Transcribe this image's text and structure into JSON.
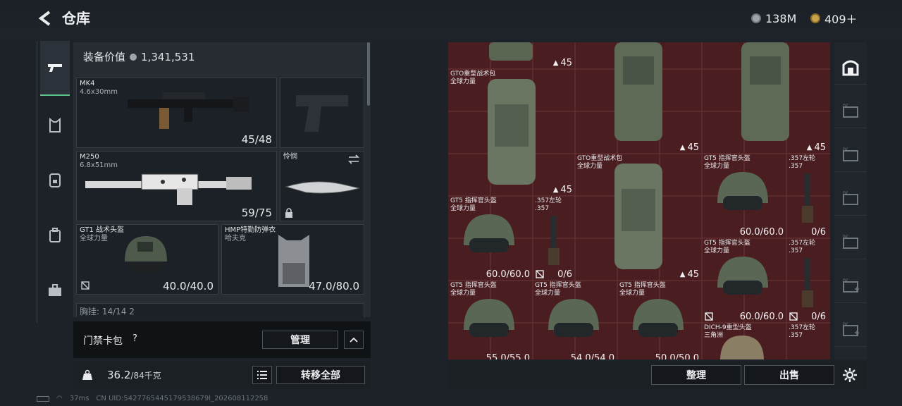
{
  "header": {
    "title": "仓库",
    "currency": [
      {
        "icon": "silver-coin-icon",
        "value": "138M"
      },
      {
        "icon": "gold-coin-icon",
        "value": "409＋"
      }
    ]
  },
  "equipment": {
    "value_label": "装备价值",
    "value": "1,341,531",
    "slots": {
      "primary1": {
        "name": "MK4",
        "caliber": "4.6x30mm",
        "durability": "45/48"
      },
      "primary2": {
        "name": "M250",
        "caliber": "6.8x51mm",
        "durability": "59/75"
      },
      "melee": {
        "name": "怜悯"
      },
      "helmet": {
        "name": "GT1 战术头盔",
        "sub": "全球力量",
        "durability": "40.0/40.0"
      },
      "armor": {
        "name": "HMP特勤防弹衣",
        "sub": "哈夫克",
        "durability": "47.0/80.0"
      }
    },
    "chest_rig_row": "胸挂: 14/14  2"
  },
  "access_card": {
    "label": "门禁卡包",
    "help": "?",
    "manage_label": "管理"
  },
  "weight": {
    "current": "36.2",
    "max": "/84千克"
  },
  "transfer_all_label": "转移全部",
  "inventory": {
    "items": [
      {
        "id": "bag-top",
        "qty": "45"
      },
      {
        "id": "gto-bag-1",
        "name": "GTO重型战术包",
        "sub": "全球力量",
        "qty": "45"
      },
      {
        "id": "bag-top-2",
        "qty": "45"
      },
      {
        "id": "bag-top-3",
        "qty": "45"
      },
      {
        "id": "gto-bag-2",
        "name": "GTO重型战术包",
        "sub": "全球力量",
        "qty": "45"
      },
      {
        "id": "gt5-a",
        "name": "GT5 指挥官头盔",
        "sub": "全球力量",
        "qty": "60.0/60.0"
      },
      {
        "id": "revolver-a",
        "name": ".357左轮",
        "sub": ".357",
        "qty": "0/6"
      },
      {
        "id": "gt5-b",
        "name": "GT5 指挥官头盔",
        "sub": "全球力量",
        "qty": "60.0/60.0"
      },
      {
        "id": "revolver-b",
        "name": ".357左轮",
        "sub": ".357",
        "qty": "0/6"
      },
      {
        "id": "gt5-c",
        "name": "GT5 指挥官头盔",
        "sub": "全球力量",
        "qty": "60.0/60.0"
      },
      {
        "id": "revolver-c",
        "name": ".357左轮",
        "sub": ".357",
        "qty": "0/6"
      },
      {
        "id": "gt5-d",
        "name": "GT5 指挥官头盔",
        "sub": "全球力量",
        "qty": "55.0/55.0"
      },
      {
        "id": "gt5-e",
        "name": "GT5 指挥官头盔",
        "sub": "全球力量",
        "qty": "54.0/54.0"
      },
      {
        "id": "gt5-f",
        "name": "GT5 指挥官头盔",
        "sub": "全球力量",
        "qty": "50.0/50.0"
      },
      {
        "id": "dich9",
        "name": "DICH-9重型头盔",
        "sub": "三角洲",
        "qty": ""
      },
      {
        "id": "revolver-d",
        "name": ".357左轮",
        "sub": ".357",
        "qty": ""
      }
    ]
  },
  "actions": {
    "sort_label": "整理",
    "sell_label": "出售"
  },
  "right_nav": [
    "vault-icon",
    "case-iv-icon",
    "case-iv-icon",
    "case-iv-icon",
    "case-iv-icon",
    "case-iv-add-icon",
    "case-iv-add-icon"
  ],
  "status": {
    "ping": "37ms",
    "uid": "CN UID:5427765445179538679l_202608112258"
  },
  "colors": {
    "accent": "#5ec28d",
    "grid_bg": "#4a1e21",
    "panel_bg": "#262c32"
  }
}
